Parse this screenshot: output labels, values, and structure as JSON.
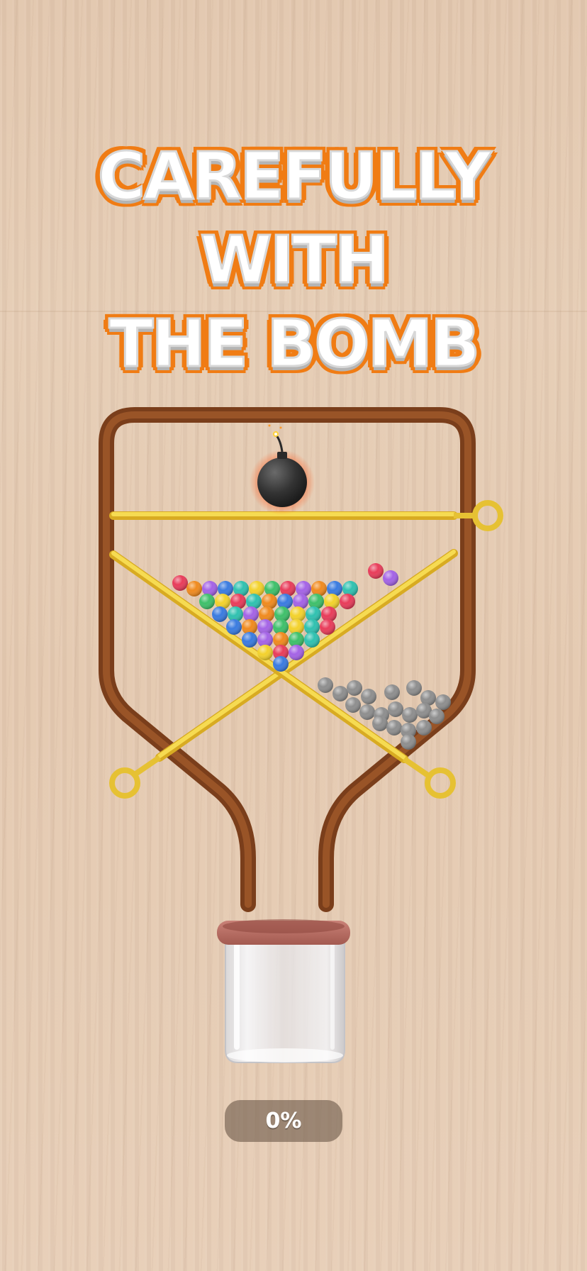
{
  "level": {
    "title_lines": [
      "CAREFULLY WITH",
      "THE BOMB"
    ],
    "progress_label": "0%",
    "progress_fraction": 0
  },
  "colors": {
    "title_fill": "#ffffff",
    "title_outline": "#f07c14",
    "container": "#8b4a22",
    "pin": "#f2d13c",
    "bomb": "#3a3a3a",
    "jar_lid": "#b86a60",
    "gray_ball": "#8e8e8e"
  },
  "pins": [
    {
      "name": "top-horizontal-pin",
      "ring_side": "right"
    },
    {
      "name": "diagonal-pin-left-ring",
      "ring_side": "left"
    },
    {
      "name": "diagonal-pin-right-ring",
      "ring_side": "right"
    }
  ],
  "balls": {
    "colored_count": 48,
    "gray_count": 20,
    "palette": [
      "#e83c5a",
      "#3a7be0",
      "#3ec06a",
      "#f3d22c",
      "#f08a1e",
      "#a463e6",
      "#2fc1b0"
    ]
  },
  "icons": {
    "bomb": "bomb-icon",
    "jar": "glass-jar-icon"
  }
}
